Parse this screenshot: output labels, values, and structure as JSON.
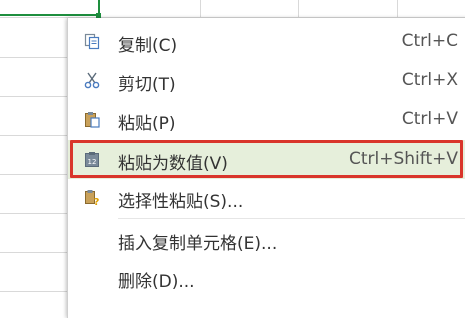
{
  "menu": {
    "items": [
      {
        "label": "复制(C)",
        "shortcut": "Ctrl+C",
        "icon": "copy-icon"
      },
      {
        "label": "剪切(T)",
        "shortcut": "Ctrl+X",
        "icon": "scissors-icon"
      },
      {
        "label": "粘贴(P)",
        "shortcut": "Ctrl+V",
        "icon": "paste-icon"
      },
      {
        "label": "粘贴为数值(V)",
        "shortcut": "Ctrl+Shift+V",
        "icon": "paste-values-icon",
        "icon_text": "12"
      },
      {
        "label": "选择性粘贴(S)...",
        "shortcut": "",
        "icon": "paste-special-icon"
      },
      {
        "label": "插入复制单元格(E)...",
        "shortcut": "",
        "icon": ""
      },
      {
        "label": "删除(D)...",
        "shortcut": "",
        "icon": ""
      }
    ],
    "highlighted_item": "粘贴为数值(V)"
  },
  "colors": {
    "selection_green": "#1e8e3e",
    "highlight_red": "#d9352b",
    "active_row_bg": "#e6efdb",
    "icon_blue": "#4a7bbf",
    "icon_gray": "#7a8a99"
  }
}
